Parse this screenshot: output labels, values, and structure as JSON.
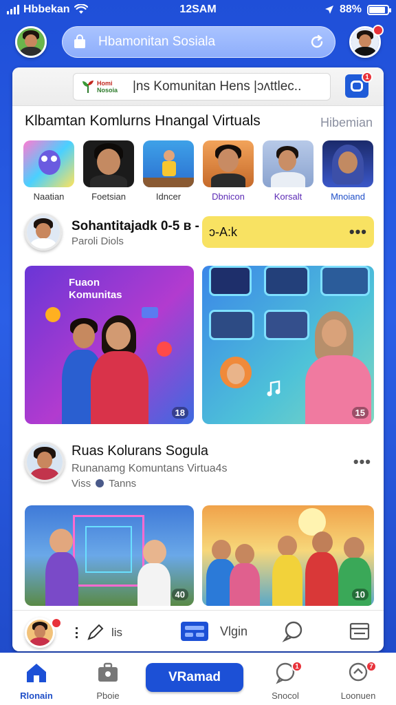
{
  "status": {
    "carrier": "Hbbekan",
    "time": "12SAM",
    "battery": "88%",
    "battery_level": 0.88
  },
  "header": {
    "search_text": "Hbamonitan Sosiala"
  },
  "ad": {
    "logo_line1": "Homi",
    "logo_line2": "Nosoia",
    "text": "|ns Komunitan Hens  |ɔʌttlec..",
    "badge": "1"
  },
  "section": {
    "title": "Klbamtan Komlurns Hnangal Virtuals",
    "link": "Hibemian"
  },
  "stories": [
    {
      "label": "Naatian"
    },
    {
      "label": "Foetsian"
    },
    {
      "label": "Idncer"
    },
    {
      "label": "Dbnicon"
    },
    {
      "label": "Korsalt"
    },
    {
      "label": "Mnoiand"
    }
  ],
  "post1": {
    "name": "Sohantitajadk 0-5 в -",
    "sub": "Paroli Diols",
    "highlight": "ɔ-A:k",
    "more": "•••",
    "left_caption_1": "Fuaon",
    "left_caption_2": "Komunitas",
    "left_counter": "18",
    "right_counter": "15"
  },
  "post2": {
    "name": "Ruas Kolurans Sogula",
    "sub1": "Runanamg Komuntans Virtua4s",
    "sub2": "Viss",
    "sub2_tail": "Tanns",
    "more": "•••",
    "left_counter": "40",
    "right_counter": "10"
  },
  "actions": {
    "edit_label": "lis",
    "video_label": "Vlgin"
  },
  "nav": {
    "home": "Rlonain",
    "profile": "Pboie",
    "cta": "VRamad",
    "social": "Snocol",
    "last": "Loonuen",
    "social_badge": "1",
    "last_badge": "7"
  },
  "colors": {
    "accent": "#1c50d6",
    "background": "#2b5fe6",
    "highlight": "#f8e262",
    "badge": "#e8323a"
  }
}
